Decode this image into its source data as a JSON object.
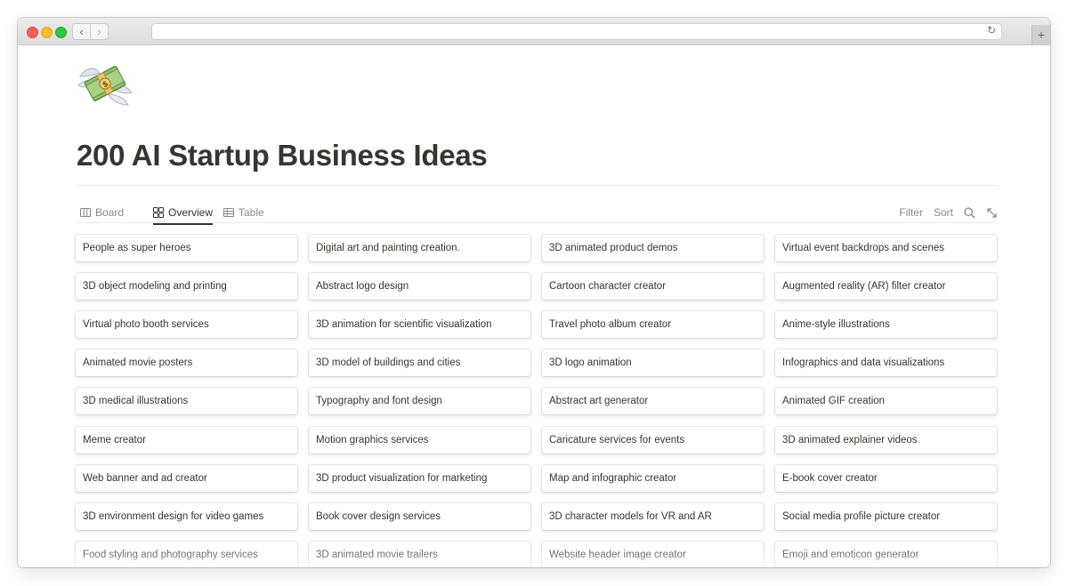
{
  "page": {
    "title": "200 AI Startup Business Ideas",
    "icon": "money-with-wings-icon"
  },
  "views": [
    {
      "label": "Board",
      "icon": "board-icon"
    },
    {
      "label": "Overview",
      "icon": "gallery-icon",
      "active": true
    },
    {
      "label": "Table",
      "icon": "table-icon"
    }
  ],
  "tools": {
    "filter": "Filter",
    "sort": "Sort",
    "search_icon": "search-icon",
    "expand_icon": "expand-icon"
  },
  "cards": [
    [
      "People as super heroes",
      "Digital art and painting creation.",
      "3D animated product demos",
      "Virtual event backdrops and scenes"
    ],
    [
      "3D object modeling and printing",
      "Abstract logo design",
      "Cartoon character creator",
      "Augmented reality (AR) filter creator"
    ],
    [
      "Virtual photo booth services",
      "3D animation for scientific visualization",
      "Travel photo album creator",
      "Anime-style illustrations"
    ],
    [
      "Animated movie posters",
      "3D model of buildings and cities",
      "3D logo animation",
      "Infographics and data visualizations"
    ],
    [
      "3D medical illustrations",
      "Typography and font design",
      "Abstract art generator",
      "Animated GIF creation"
    ],
    [
      "Meme creator",
      "Motion graphics services",
      "Caricature services for events",
      "3D animated explainer videos"
    ],
    [
      "Web banner and ad creator",
      "3D product visualization for marketing",
      "Map and infographic creator",
      "E-book cover creator"
    ],
    [
      "3D environment design for video games",
      "Book cover design services",
      "3D character models for VR and AR",
      "Social media profile picture creator"
    ],
    [
      "Food styling and photography services",
      "3D animated movie trailers",
      "Website header image creator",
      "Emoji and emoticon generator"
    ]
  ],
  "colors": {
    "text": "#37352f",
    "muted": "#8a8985",
    "close": "#fe5f57",
    "minimize": "#febc2e",
    "zoom": "#28c840"
  }
}
